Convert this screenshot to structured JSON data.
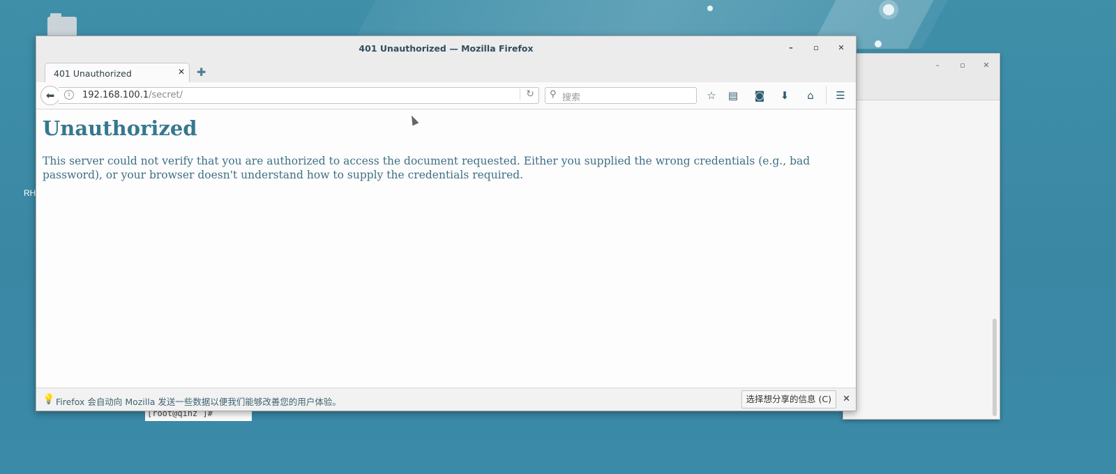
{
  "window": {
    "title": "401 Unauthorized — Mozilla Firefox"
  },
  "tabs": [
    {
      "label": "401 Unauthorized"
    }
  ],
  "urlbar": {
    "host": "192.168.100.1",
    "path": "/secret/"
  },
  "search": {
    "placeholder": "搜索"
  },
  "page": {
    "heading": "Unauthorized",
    "body": "This server could not verify that you are authorized to access the document requested. Either you supplied the wrong credentials (e.g., bad password), or your browser doesn't understand how to supply the credentials required."
  },
  "notification": {
    "text": "Firefox 会自动向 Mozilla 发送一些数据以便我们能够改善您的用户体验。",
    "button_label": "选择想分享的信息 (C)"
  },
  "desktop": {
    "label": "RH",
    "terminal_prompt": "[root@qinz  ]# "
  },
  "colors": {
    "desktop_bg": "#3a87a4",
    "heading": "#36788e",
    "text": "#3d7083"
  },
  "icons": {
    "back": "arrow-left",
    "info": "info-circle",
    "reload": "reload",
    "search": "magnifier",
    "bookmark": "star",
    "library": "reading-list",
    "pocket": "pocket",
    "download": "arrow-down",
    "home": "house",
    "menu": "hamburger",
    "new_tab": "plus",
    "bulb": "lightbulb"
  }
}
